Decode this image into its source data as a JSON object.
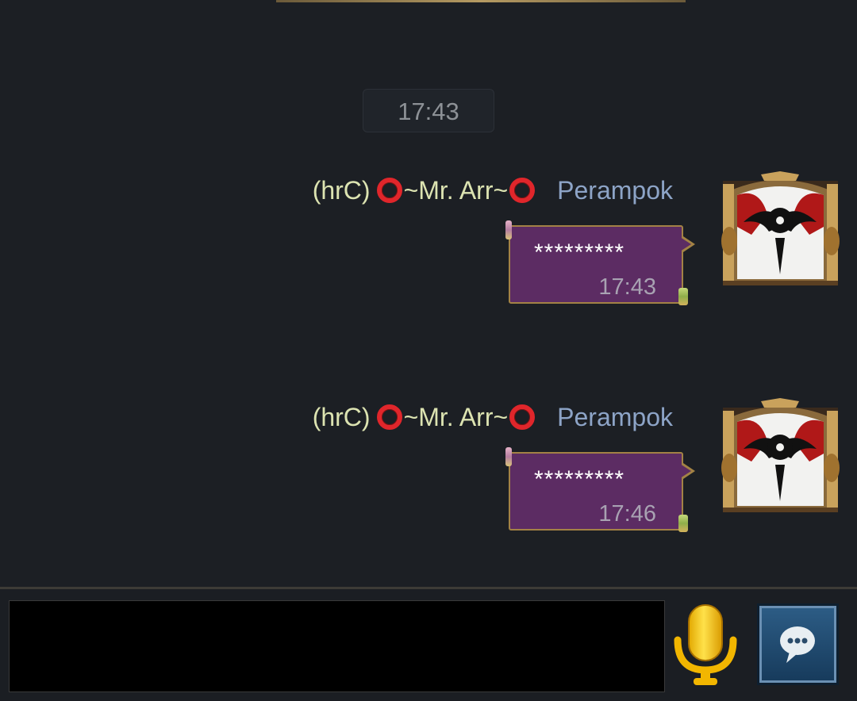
{
  "chat": {
    "divider_time": "17:43",
    "messages": [
      {
        "guild_tag": "(hrC)",
        "name_prefix": "~Mr. Arr~",
        "rank": "Perampok",
        "text": "*********",
        "time": "17:43",
        "avatar": "guild-emblem-icon"
      },
      {
        "guild_tag": "(hrC)",
        "name_prefix": "~Mr. Arr~",
        "rank": "Perampok",
        "text": "*********",
        "time": "17:46",
        "avatar": "guild-emblem-icon"
      }
    ]
  },
  "input_bar": {
    "input_value": "",
    "mic_icon": "microphone-icon",
    "send_icon": "chat-bubble-icon"
  },
  "colors": {
    "background": "#1c1f24",
    "bubble": "#5c2c63",
    "bubble_border": "#a38245",
    "name": "#dce3b1",
    "rank": "#8da4c7",
    "ring": "#e0262b"
  }
}
